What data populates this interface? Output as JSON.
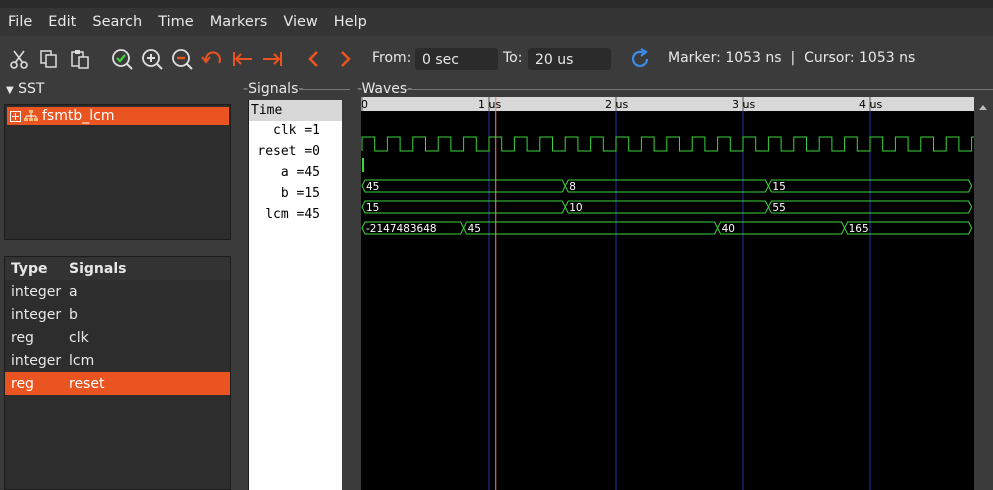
{
  "menu": [
    "File",
    "Edit",
    "Search",
    "Time",
    "Markers",
    "View",
    "Help"
  ],
  "toolbar": {
    "icons": [
      "cut-icon",
      "copy-icon",
      "paste-icon",
      "zoom-fit-icon",
      "zoom-in-icon",
      "zoom-out-icon",
      "undo-icon",
      "zoom-start-icon",
      "zoom-end-icon",
      "prev-icon",
      "next-icon",
      "reload-icon"
    ],
    "from_label": "From:",
    "from_value": "0 sec",
    "to_label": "To:",
    "to_value": "20 us",
    "marker_text": "Marker: 1053 ns  |  Cursor: 1053 ns"
  },
  "sst": {
    "title": "SST",
    "tree_item": "fsmtb_lcm"
  },
  "types": {
    "col_type": "Type",
    "col_signals": "Signals",
    "rows": [
      {
        "type": "integer",
        "signal": "a"
      },
      {
        "type": "integer",
        "signal": "b"
      },
      {
        "type": "reg",
        "signal": "clk"
      },
      {
        "type": "integer",
        "signal": "lcm"
      },
      {
        "type": "reg",
        "signal": "reset"
      }
    ],
    "selected_index": 4
  },
  "signals": {
    "title": "Signals",
    "header": "Time",
    "rows": [
      "clk =1",
      "reset =0",
      "a =45",
      "b =15",
      "lcm =45"
    ]
  },
  "waves": {
    "title": "Waves",
    "ticks": [
      "0",
      "1 us",
      "2 us",
      "3 us",
      "4 us"
    ],
    "tick_times_us": [
      0,
      1,
      2,
      3,
      4
    ],
    "marker_time_ns": 1053,
    "clk_period_ns": 200,
    "reset_high_until_ns": 15,
    "buses": [
      {
        "name": "a",
        "segments": [
          {
            "start": 0,
            "end": 1600,
            "value": "45"
          },
          {
            "start": 1600,
            "end": 3200,
            "value": "8"
          },
          {
            "start": 3200,
            "end": 4800,
            "value": "15"
          }
        ]
      },
      {
        "name": "b",
        "segments": [
          {
            "start": 0,
            "end": 1600,
            "value": "15"
          },
          {
            "start": 1600,
            "end": 3200,
            "value": "10"
          },
          {
            "start": 3200,
            "end": 4800,
            "value": "55"
          }
        ]
      },
      {
        "name": "lcm",
        "segments": [
          {
            "start": 0,
            "end": 800,
            "value": "-2147483648"
          },
          {
            "start": 800,
            "end": 2800,
            "value": "45"
          },
          {
            "start": 2800,
            "end": 3800,
            "value": "40"
          },
          {
            "start": 3800,
            "end": 4800,
            "value": "165"
          }
        ]
      }
    ]
  },
  "colors": {
    "accent": "#e95420",
    "wave": "#3bd43b",
    "grid": "#3030a0",
    "marker": "#ff7a7a"
  }
}
